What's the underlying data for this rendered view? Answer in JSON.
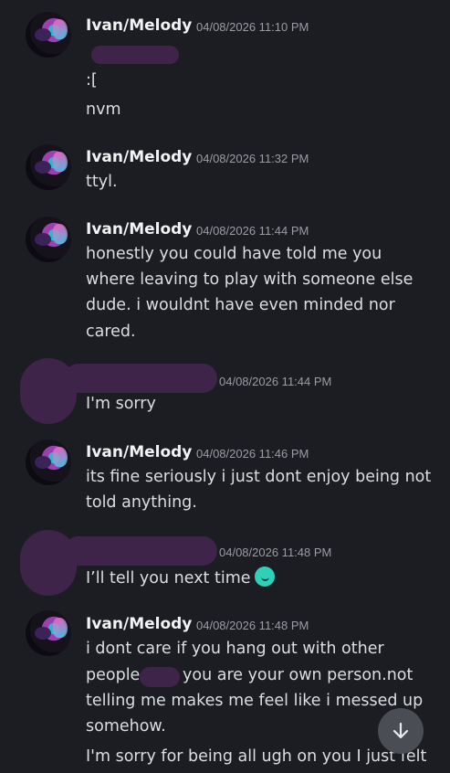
{
  "messages": [
    {
      "author": "Ivan/Melody",
      "time": "04/08/2026 11:10 PM",
      "lines": [
        ":[",
        "nvm"
      ]
    },
    {
      "author": "Ivan/Melody",
      "time": "04/08/2026 11:32 PM",
      "lines": [
        "ttyl."
      ]
    },
    {
      "author": "Ivan/Melody",
      "time": "04/08/2026 11:44 PM",
      "lines": [
        "honestly you could have told me you",
        "where leaving to play with someone else",
        "dude. i wouldnt have even minded nor",
        "cared."
      ]
    },
    {
      "author": "",
      "time": "04/08/2026 11:44 PM",
      "lines": [
        "I'm sorry"
      ]
    },
    {
      "author": "Ivan/Melody",
      "time": "04/08/2026 11:46 PM",
      "lines": [
        "its fine seriously i just dont enjoy being not",
        "told anything."
      ]
    },
    {
      "author": "",
      "time": "04/08/2026 11:48 PM",
      "lines": [
        "I’ll tell you next time"
      ]
    },
    {
      "author": "Ivan/Melody",
      "time": "04/08/2026 11:48 PM",
      "lines": [
        "i dont care if you hang out with other",
        "people",
        "you are your own person.not",
        "telling me makes me feel like i messed up",
        "somehow.",
        "I'm sorry for being all ugh on you I just felt"
      ]
    }
  ],
  "scroll_button": {
    "icon": "arrow-down-icon"
  }
}
